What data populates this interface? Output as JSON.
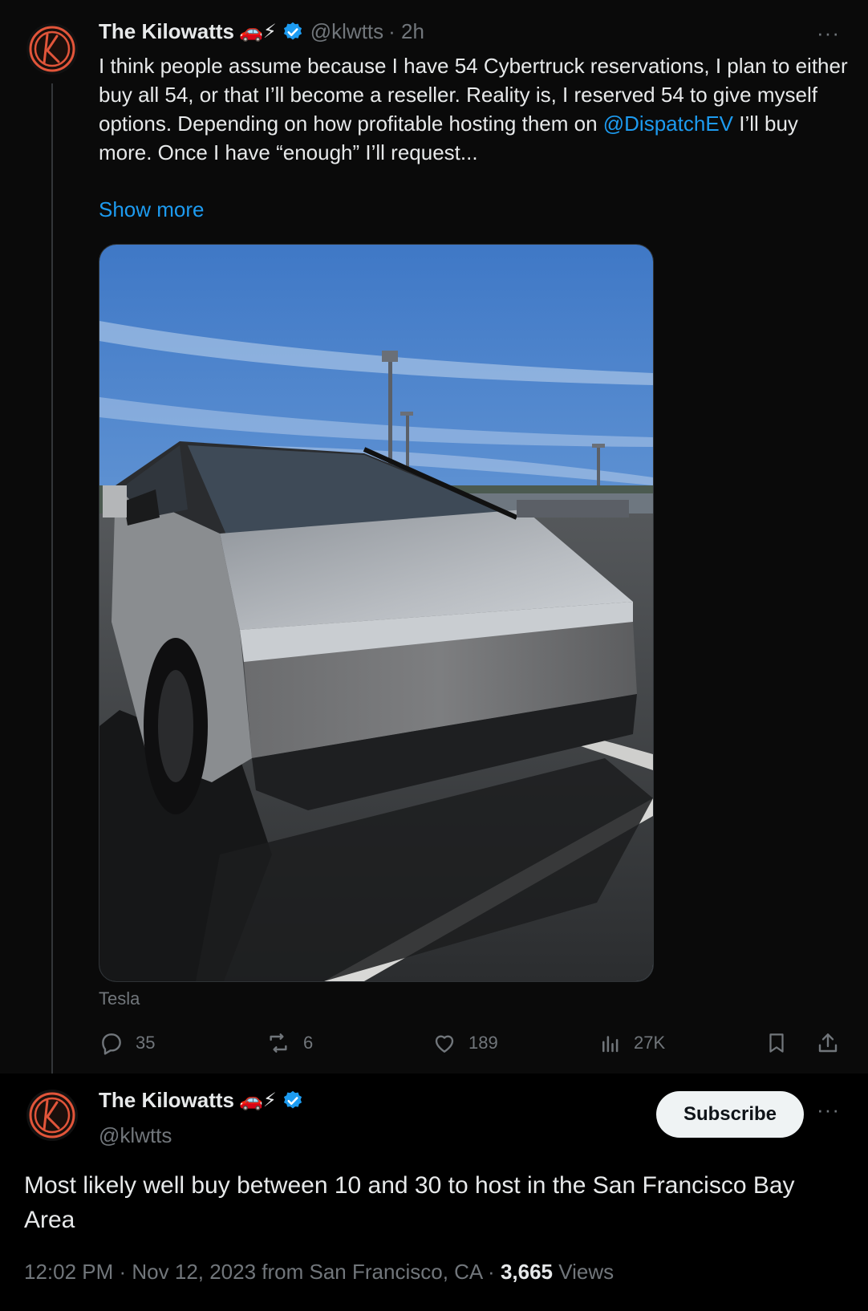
{
  "tweet": {
    "author_name": "The Kilowatts",
    "author_emojis": "🚗⚡",
    "handle": "@klwtts",
    "time_ago": "· 2h",
    "more_label": "···",
    "text_part1": "I think people assume because I have 54 Cybertruck reservations, I plan to either buy all 54, or that I’ll become a reseller. Reality is, I reserved 54 to give myself options. Depending on how profitable hosting them on ",
    "mention": "@DispatchEV",
    "text_part2": " I’ll buy more. Once I have “enough” I’ll request...",
    "show_more": "Show more",
    "media_caption": "Tesla",
    "stats": {
      "replies": "35",
      "reposts": "6",
      "likes": "189",
      "views": "27K"
    }
  },
  "reply": {
    "author_name": "The Kilowatts",
    "author_emojis": "🚗⚡",
    "handle": "@klwtts",
    "subscribe_label": "Subscribe",
    "more_label": "···",
    "text": "Most likely well buy between 10 and 30 to host in the San Francisco Bay Area",
    "timestamp": "12:02 PM · Nov 12, 2023 from San Francisco, CA · ",
    "views_count": "3,665",
    "views_label": " Views"
  },
  "colors": {
    "accent": "#1d9bf0",
    "muted": "#71767b",
    "text": "#e7e9ea",
    "background": "#000000"
  }
}
